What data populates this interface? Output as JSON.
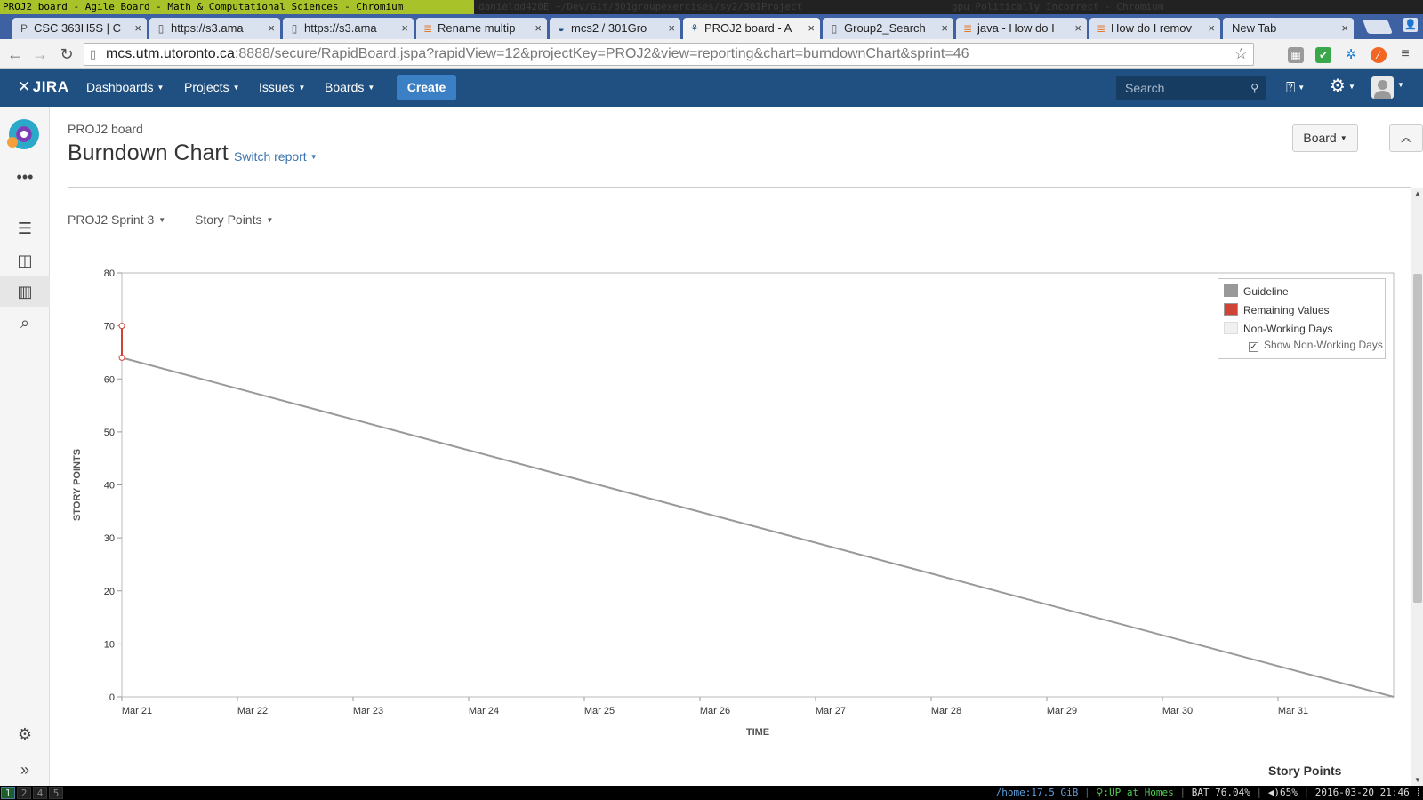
{
  "wm": {
    "title": "PROJ2 board - Agile Board - Math & Computational Sciences - Chromium",
    "dim_left": "danieldd420E  ~/Dev/Git/301groupexercises/sy2/301Project",
    "dim_right": "gpu   Politically Incorrect - Chromium"
  },
  "tabs": [
    {
      "label": "CSC 363H5S | C",
      "icon": "P"
    },
    {
      "label": "https://s3.ama",
      "icon": "▯"
    },
    {
      "label": "https://s3.ama",
      "icon": "▯"
    },
    {
      "label": "Rename multip",
      "icon": "≣"
    },
    {
      "label": "mcs2 / 301Gro",
      "icon": "◒"
    },
    {
      "label": "PROJ2 board - A",
      "icon": "⚘"
    },
    {
      "label": "Group2_Search",
      "icon": "▯"
    },
    {
      "label": "java - How do I",
      "icon": "≣"
    },
    {
      "label": "How do I remov",
      "icon": "≣"
    },
    {
      "label": "New Tab",
      "icon": ""
    }
  ],
  "omnibox": {
    "host": "mcs.utm.utoronto.ca",
    "rest": ":8888/secure/RapidBoard.jspa?rapidView=12&projectKey=PROJ2&view=reporting&chart=burndownChart&sprint=46"
  },
  "jira": {
    "logo": "JIRA",
    "nav": [
      "Dashboards",
      "Projects",
      "Issues",
      "Boards"
    ],
    "create": "Create",
    "search_placeholder": "Search"
  },
  "page": {
    "breadcrumb": "PROJ2 board",
    "title": "Burndown Chart",
    "switch_report": "Switch report",
    "board_button": "Board",
    "sprint_filter": "PROJ2 Sprint 3",
    "estimation_filter": "Story Points"
  },
  "legend": {
    "guideline": "Guideline",
    "remaining": "Remaining Values",
    "non_working": "Non-Working Days",
    "show_non_working": "Show Non-Working Days"
  },
  "story_points_heading": "Story Points",
  "statusbar": {
    "workspaces": [
      "1",
      "2",
      "4",
      "5"
    ],
    "home": "/home:17.5 GiB",
    "wifi": "UP at Homes",
    "battery": "BAT 76.04%",
    "volume": "65%",
    "datetime": "2016-03-20 21:46"
  },
  "colors": {
    "jira_header": "#205081",
    "guideline": "#999999",
    "remaining": "#d04437",
    "non_working": "#f0f0f0"
  },
  "chart_data": {
    "type": "line",
    "xlabel": "TIME",
    "ylabel": "STORY POINTS",
    "ylim": [
      0,
      80
    ],
    "yticks": [
      0,
      10,
      20,
      30,
      40,
      50,
      60,
      70,
      80
    ],
    "xticks": [
      "Mar 21",
      "Mar 22",
      "Mar 23",
      "Mar 24",
      "Mar 25",
      "Mar 26",
      "Mar 27",
      "Mar 28",
      "Mar 29",
      "Mar 30",
      "Mar 31"
    ],
    "xlim_days": [
      0,
      11
    ],
    "series": [
      {
        "name": "Guideline",
        "points": [
          {
            "x": "Mar 21",
            "y": 64
          },
          {
            "x": "Apr 1",
            "y": 0
          }
        ]
      },
      {
        "name": "Remaining Values",
        "points": [
          {
            "x": "Mar 21",
            "y": 70
          },
          {
            "x": "Mar 21",
            "y": 64
          }
        ]
      }
    ],
    "legend_position": "top-right",
    "grid": false
  }
}
